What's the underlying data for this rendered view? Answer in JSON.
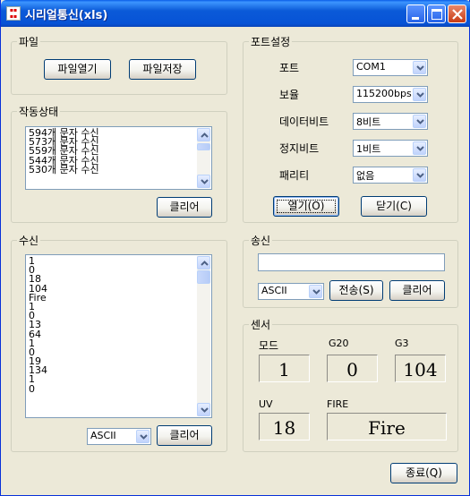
{
  "window": {
    "title": "시리얼통신(xls)",
    "icon_label": "Serial"
  },
  "file_group": {
    "label": "파일",
    "open_button": "파일열기",
    "save_button": "파일저장"
  },
  "status_group": {
    "label": "작동상태",
    "items": [
      "594개 문자 수신",
      "573개 문자 수신",
      "559개 문자 수신",
      "544개 문자 수신",
      "530개 문자 수신"
    ],
    "clear_button": "클리어"
  },
  "port_group": {
    "label": "포트설정",
    "port_label": "포트",
    "port_value": "COM1",
    "baud_label": "보율",
    "baud_value": "115200bps",
    "databits_label": "데이터비트",
    "databits_value": "8비트",
    "stopbits_label": "정지비트",
    "stopbits_value": "1비트",
    "parity_label": "패리티",
    "parity_value": "없음",
    "open_button": "열기(O)",
    "close_button": "닫기(C)"
  },
  "receive_group": {
    "label": "수신",
    "items": [
      "1",
      "0",
      "18",
      "104",
      "Fire",
      "1",
      "0",
      "13",
      "64",
      "1",
      "0",
      "19",
      "134",
      "1",
      "0"
    ],
    "mode_value": "ASCII",
    "clear_button": "클리어"
  },
  "send_group": {
    "label": "송신",
    "input_value": "",
    "mode_value": "ASCII",
    "send_button": "전송(S)",
    "clear_button": "클리어"
  },
  "sensor_group": {
    "label": "센서",
    "mode_label": "모드",
    "mode_value": "1",
    "g20_label": "G20",
    "g20_value": "0",
    "g3_label": "G3",
    "g3_value": "104",
    "uv_label": "UV",
    "uv_value": "18",
    "fire_label": "FIRE",
    "fire_value": "Fire"
  },
  "footer": {
    "exit_button": "종료(Q)"
  }
}
